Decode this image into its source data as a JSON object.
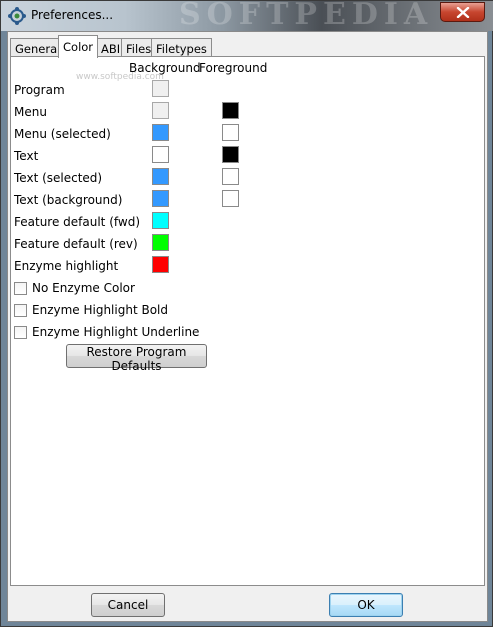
{
  "window": {
    "title": "Preferences...",
    "watermark": "SOFTPEDIA"
  },
  "tabs": [
    {
      "label": "General",
      "active": false
    },
    {
      "label": "Color",
      "active": true
    },
    {
      "label": "ABI",
      "active": false
    },
    {
      "label": "Files",
      "active": false
    },
    {
      "label": "Filetypes",
      "active": false
    }
  ],
  "color_panel": {
    "watermark_url": "www.softpedia.com",
    "headers": {
      "background": "Background",
      "foreground": "Foreground"
    },
    "rows": [
      {
        "label": "Program",
        "background": "#f0f0f0",
        "foreground": null
      },
      {
        "label": "Menu",
        "background": "#f0f0f0",
        "foreground": "#000000"
      },
      {
        "label": "Menu (selected)",
        "background": "#3399ff",
        "foreground": "#ffffff"
      },
      {
        "label": "Text",
        "background": "#ffffff",
        "foreground": "#000000"
      },
      {
        "label": "Text (selected)",
        "background": "#3399ff",
        "foreground": "#ffffff"
      },
      {
        "label": "Text (background)",
        "background": "#3399ff",
        "foreground": "#ffffff"
      },
      {
        "label": "Feature default (fwd)",
        "background": "#00ffff",
        "foreground": null
      },
      {
        "label": "Feature default (rev)",
        "background": "#00ff00",
        "foreground": null
      },
      {
        "label": "Enzyme highlight",
        "background": "#ff0000",
        "foreground": null
      }
    ],
    "checkboxes": [
      {
        "label": "No Enzyme Color",
        "checked": false
      },
      {
        "label": "Enzyme Highlight Bold",
        "checked": false
      },
      {
        "label": "Enzyme Highlight Underline",
        "checked": false
      }
    ],
    "restore_label": "Restore Program Defaults"
  },
  "footer": {
    "cancel_label": "Cancel",
    "ok_label": "OK"
  }
}
